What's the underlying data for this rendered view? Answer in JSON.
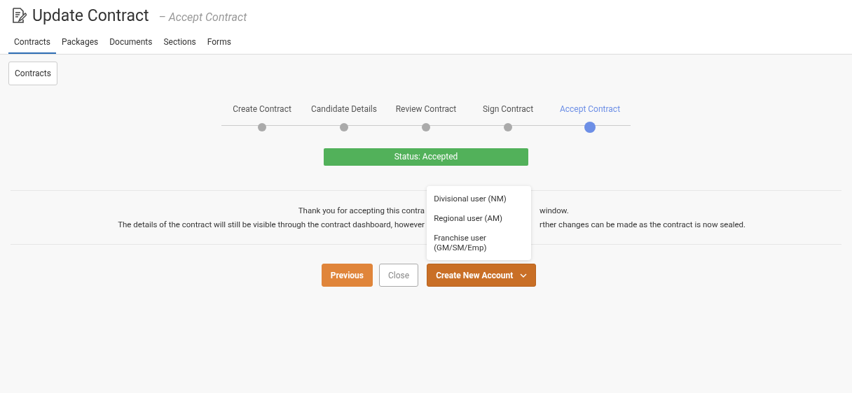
{
  "header": {
    "title": "Update Contract",
    "subtitle": "– Accept Contract"
  },
  "tabs": [
    {
      "label": "Contracts",
      "selected": true
    },
    {
      "label": "Packages",
      "selected": false
    },
    {
      "label": "Documents",
      "selected": false
    },
    {
      "label": "Sections",
      "selected": false
    },
    {
      "label": "Forms",
      "selected": false
    }
  ],
  "breadcrumb_button": "Contracts",
  "steps": [
    {
      "label": "Create Contract",
      "selected": false
    },
    {
      "label": "Candidate Details",
      "selected": false
    },
    {
      "label": "Review Contract",
      "selected": false
    },
    {
      "label": "Sign Contract",
      "selected": false
    },
    {
      "label": "Accept Contract",
      "selected": true
    }
  ],
  "status": "Status: Accepted",
  "message_lines": [
    {
      "left": "Thank you for accepting this contra",
      "right": "window."
    },
    {
      "left": "The details of the contract will still be visible through the contract dashboard, however",
      "right": "rther changes can be made as the contract is now sealed."
    }
  ],
  "buttons": [
    {
      "label": "Previous",
      "kind": "primary"
    },
    {
      "label": "Close",
      "kind": "outline"
    },
    {
      "label": "Create New Account",
      "kind": "dropdown",
      "expanded": true
    }
  ],
  "dropdown_menu": [
    "Divisional user (NM)",
    "Regional user (AM)",
    "Franchise user (GM/SM/Emp)"
  ]
}
